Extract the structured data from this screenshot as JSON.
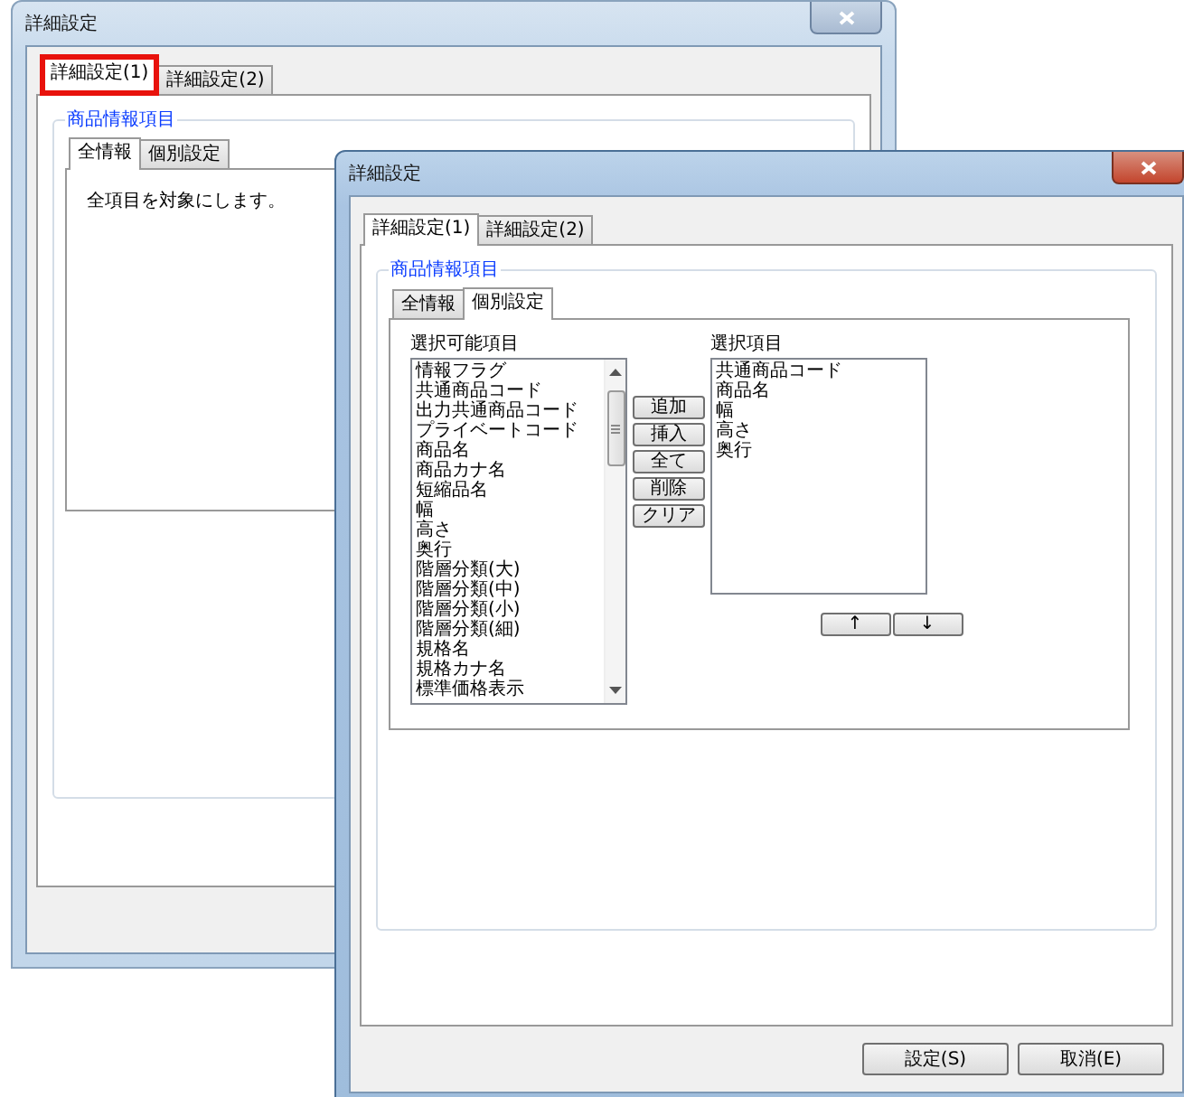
{
  "back_window": {
    "title": "詳細設定",
    "tabs": [
      {
        "label": "詳細設定(1)",
        "selected": true,
        "highlighted": true
      },
      {
        "label": "詳細設定(2)",
        "selected": false,
        "highlighted": false
      }
    ],
    "group_title": "商品情報項目",
    "inner_tabs": [
      {
        "label": "全情報",
        "selected": true
      },
      {
        "label": "個別設定",
        "selected": false
      }
    ],
    "message": "全項目を対象にします。"
  },
  "front_window": {
    "title": "詳細設定",
    "tabs": [
      {
        "label": "詳細設定(1)",
        "selected": true,
        "highlighted": false
      },
      {
        "label": "詳細設定(2)",
        "selected": false,
        "highlighted": false
      }
    ],
    "group_title": "商品情報項目",
    "inner_tabs": [
      {
        "label": "全情報",
        "selected": false
      },
      {
        "label": "個別設定",
        "selected": true
      }
    ],
    "available_label": "選択可能項目",
    "available_items": [
      "情報フラグ",
      "共通商品コード",
      "出力共通商品コード",
      "プライベートコード",
      "商品名",
      "商品カナ名",
      "短縮品名",
      "幅",
      "高さ",
      "奥行",
      "階層分類(大)",
      "階層分類(中)",
      "階層分類(小)",
      "階層分類(細)",
      "規格名",
      "規格カナ名",
      "標準価格表示"
    ],
    "action_buttons": [
      "追加",
      "挿入",
      "全て",
      "削除",
      "クリア"
    ],
    "selected_label": "選択項目",
    "selected_items": [
      "共通商品コード",
      "商品名",
      "幅",
      "高さ",
      "奥行"
    ],
    "order_buttons": [
      "↑",
      "↓"
    ],
    "footer_buttons": [
      "設定(S)",
      "取消(E)"
    ]
  }
}
